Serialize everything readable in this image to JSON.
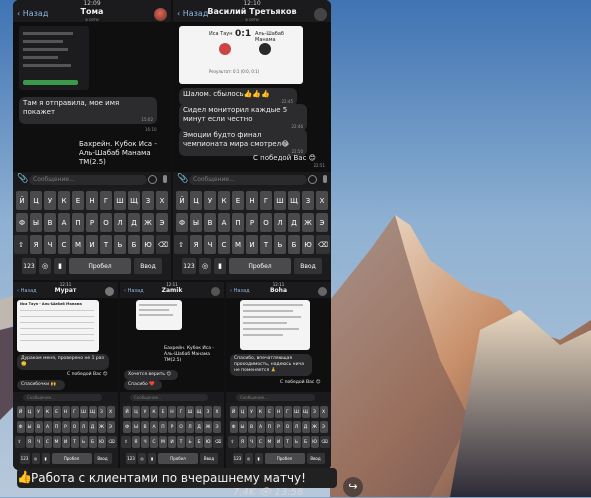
{
  "screens": {
    "tl": {
      "time": "12:09",
      "back": "Назад",
      "title": "Тома",
      "subtitle": "в сети",
      "msg1": "Там я отправила, мое имя покажет",
      "msg1_time": "15:02",
      "msg2_time": "16:10",
      "msg3": "Бахрейн. Кубок Иса - Аль-Шабаб Манама ТМ(2.5)"
    },
    "tr": {
      "time": "12:10",
      "back": "Назад",
      "title": "Василий Третьяков",
      "subtitle": "в сети",
      "score_home": "Иса Таун",
      "score": "0:1",
      "score_away": "Аль-Шабаб Манама",
      "score_result": "Результат: 0:1 (0:0, 0:1)",
      "msg1": "Шалом. сбылось👍👍👍",
      "msg1_time": "22:45",
      "msg2": "Сидел мониторил каждые 5 минут если честно",
      "msg2_time": "22:46",
      "msg3": "Эмоции будто финал чемпионата мира смотрел😂",
      "msg3_time": "22:50",
      "msg4": "С победой Вас 😊",
      "msg4_time": "22:51"
    },
    "bl": {
      "time": "12:11",
      "back": "Назад",
      "title": "Мурат",
      "subtitle": "в сети",
      "card_title": "Иса Таун - Аль-Шабаб Манама",
      "msg1": "Дураком меня, проверено не 1 раз 🙂",
      "msg1_time": "",
      "msg2": "С победой Вас 😊",
      "msg3": "Спасибочки 🙌",
      "msg3_time": ""
    },
    "bm": {
      "time": "12:11",
      "back": "Назад",
      "title": "Zamik",
      "subtitle": "в сети",
      "msg1": "Бахрейн. Кубок Иса - Аль-Шабаб Манама ТМ(2.5)",
      "msg2": "Хочется верить 😊",
      "msg3": "Спасибо ❤️"
    },
    "br": {
      "time": "12:11",
      "back": "Назад",
      "title": "Boha",
      "subtitle": "в сети",
      "msg1": "Спасибо, впечатляющая проходимость, надеюсь нича не поменяется 🙏",
      "msg2": "С победой Вас 😊"
    }
  },
  "input_placeholder": "Сообщение...",
  "keyboard": {
    "row1": [
      "Й",
      "Ц",
      "У",
      "К",
      "Е",
      "Н",
      "Г",
      "Ш",
      "Щ",
      "З",
      "Х"
    ],
    "row2": [
      "Ф",
      "Ы",
      "В",
      "А",
      "П",
      "Р",
      "О",
      "Л",
      "Д",
      "Ж",
      "Э"
    ],
    "row3": [
      "Я",
      "Ч",
      "С",
      "М",
      "И",
      "Т",
      "Ь",
      "Б",
      "Ю"
    ],
    "num_key": "123",
    "space_key": "Пробел",
    "enter_key": "Ввод"
  },
  "caption": {
    "emoji": "👍",
    "text": "Работа с клиентами по вчерашнему матчу!"
  },
  "meta": {
    "views": "7.4K",
    "time": "13:58"
  }
}
